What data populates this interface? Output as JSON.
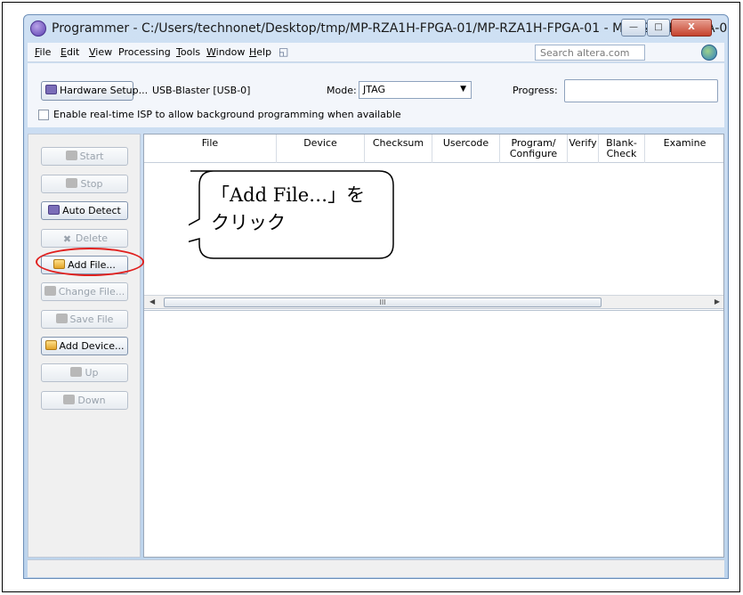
{
  "window": {
    "title": "Programmer - C:/Users/technonet/Desktop/tmp/MP-RZA1H-FPGA-01/MP-RZA1H-FPGA-01 - MP-RZA1H-FPGA-0...",
    "min_glyph": "—",
    "max_glyph": "□",
    "close_glyph": "X"
  },
  "menu": {
    "items": [
      "File",
      "Edit",
      "View",
      "Processing",
      "Tools",
      "Window",
      "Help"
    ],
    "help_icon": "help-bubble-icon",
    "search_placeholder": "Search altera.com"
  },
  "toolbar": {
    "hardware_setup_label": "Hardware Setup...",
    "cable": "USB-Blaster [USB-0]",
    "mode_label": "Mode:",
    "mode_value": "JTAG",
    "progress_label": "Progress:",
    "isp_label": "Enable real-time ISP to allow background programming when available"
  },
  "sidebar": {
    "buttons": [
      {
        "label": "Start",
        "enabled": false
      },
      {
        "label": "Stop",
        "enabled": false
      },
      {
        "label": "Auto Detect",
        "enabled": true
      },
      {
        "label": "Delete",
        "enabled": false
      },
      {
        "label": "Add File...",
        "enabled": true
      },
      {
        "label": "Change File...",
        "enabled": false
      },
      {
        "label": "Save File",
        "enabled": false
      },
      {
        "label": "Add Device...",
        "enabled": true
      },
      {
        "label": "Up",
        "enabled": false
      },
      {
        "label": "Down",
        "enabled": false
      }
    ]
  },
  "table": {
    "columns": [
      "File",
      "Device",
      "Checksum",
      "Usercode",
      "Program/ Configure",
      "Verify",
      "Blank- Check",
      "Examine"
    ],
    "scroll_grip": "III"
  },
  "annotation": {
    "line1": "「Add File…」を",
    "line2": "クリック",
    "color": "#e0201e"
  }
}
